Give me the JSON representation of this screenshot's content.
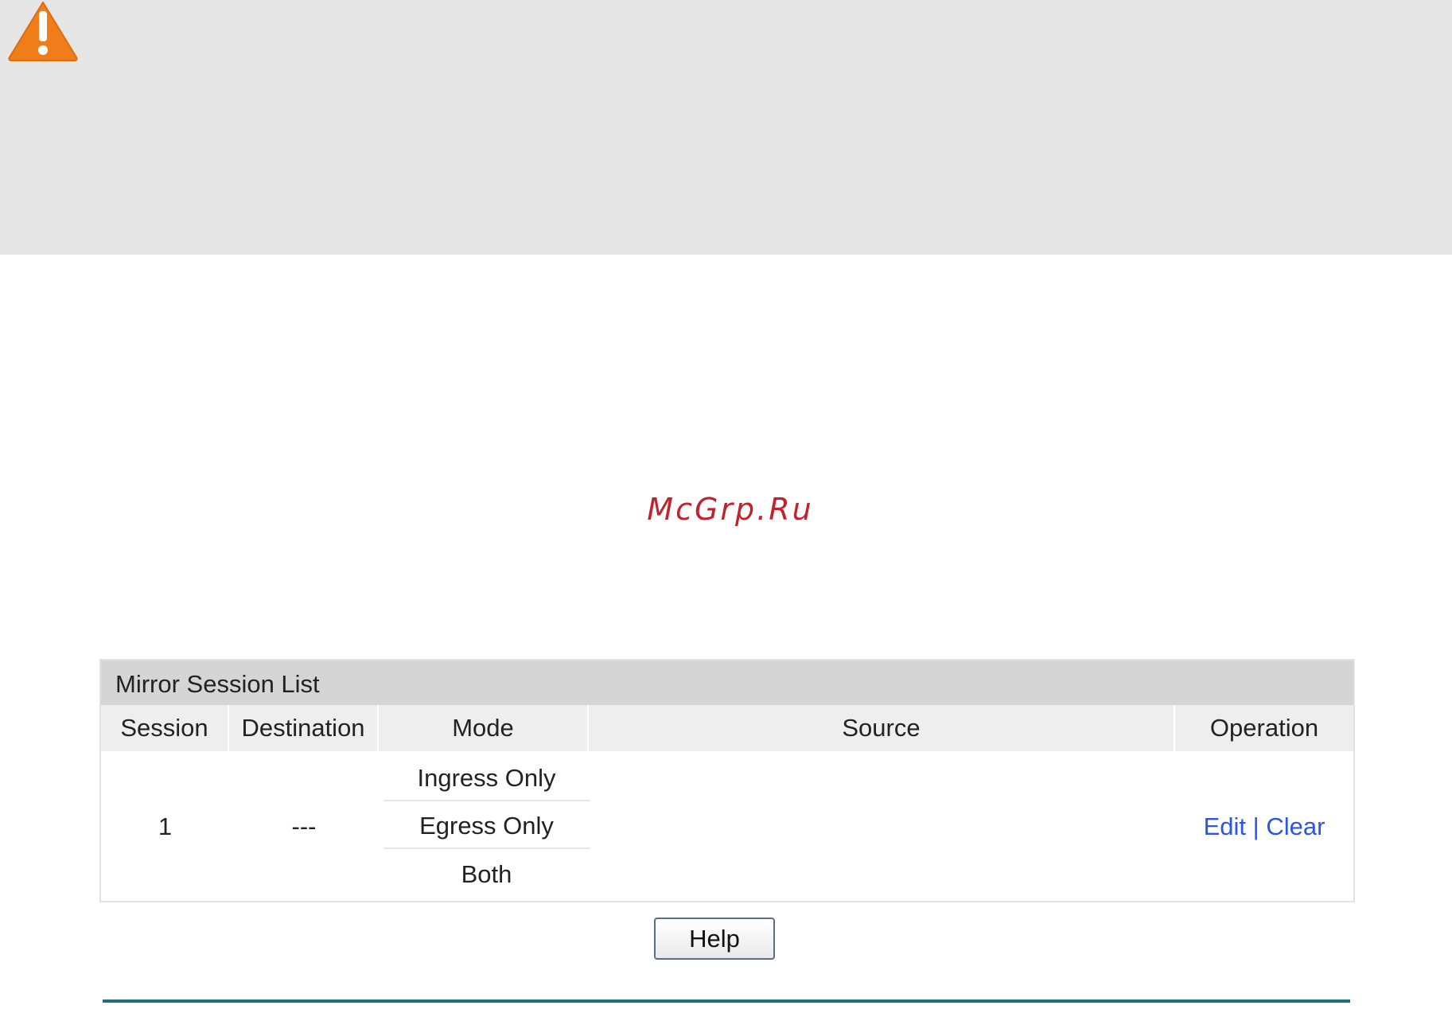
{
  "watermark": "McGrp.Ru",
  "mirror_session_list": {
    "title": "Mirror Session List",
    "headers": {
      "session": "Session",
      "destination": "Destination",
      "mode": "Mode",
      "source": "Source",
      "operation": "Operation"
    },
    "rows": [
      {
        "session": "1",
        "destination": "---",
        "modes": [
          "Ingress Only",
          "Egress Only",
          "Both"
        ],
        "source": "",
        "operation": {
          "edit": "Edit",
          "separator": "|",
          "clear": "Clear"
        }
      }
    ]
  },
  "help_button": "Help",
  "icons": {
    "warning": "warning-triangle-icon"
  },
  "colors": {
    "warning": "#ef7d1a",
    "link": "#2b55e6",
    "watermark": "#c0232e",
    "rule": "#1f6f78"
  }
}
